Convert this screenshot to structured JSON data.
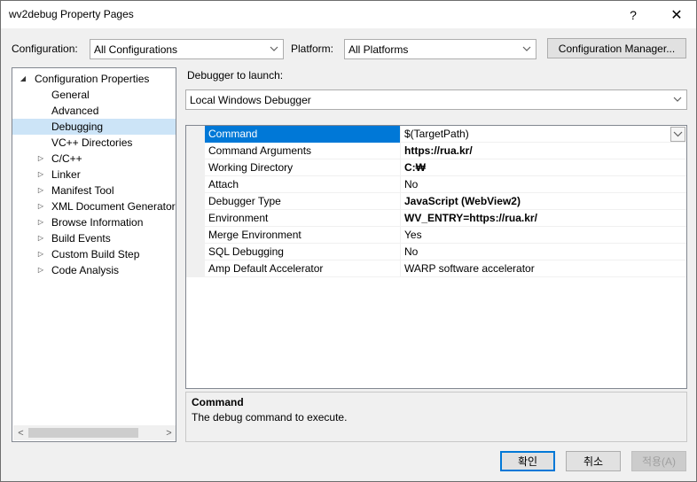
{
  "window": {
    "title": "wv2debug Property Pages",
    "help_glyph": "?",
    "close_glyph": "✕"
  },
  "toolbar": {
    "configuration_label": "Configuration:",
    "configuration_value": "All Configurations",
    "platform_label": "Platform:",
    "platform_value": "All Platforms",
    "config_manager_label": "Configuration Manager..."
  },
  "tree": {
    "items": [
      {
        "label": "Configuration Properties",
        "expander": "◢"
      },
      {
        "label": "General"
      },
      {
        "label": "Advanced"
      },
      {
        "label": "Debugging",
        "selected": true
      },
      {
        "label": "VC++ Directories"
      },
      {
        "label": "C/C++",
        "expander": "▷"
      },
      {
        "label": "Linker",
        "expander": "▷"
      },
      {
        "label": "Manifest Tool",
        "expander": "▷"
      },
      {
        "label": "XML Document Generator",
        "expander": "▷"
      },
      {
        "label": "Browse Information",
        "expander": "▷"
      },
      {
        "label": "Build Events",
        "expander": "▷"
      },
      {
        "label": "Custom Build Step",
        "expander": "▷"
      },
      {
        "label": "Code Analysis",
        "expander": "▷"
      }
    ],
    "scroll_left": "<",
    "scroll_right": ">"
  },
  "debugger": {
    "launch_label": "Debugger to launch:",
    "launch_value": "Local Windows Debugger"
  },
  "properties": [
    {
      "name": "Command",
      "value": "$(TargetPath)",
      "bold": false,
      "selected": true
    },
    {
      "name": "Command Arguments",
      "value": "https://rua.kr/",
      "bold": true
    },
    {
      "name": "Working Directory",
      "value": "C:₩",
      "bold": true
    },
    {
      "name": "Attach",
      "value": "No",
      "bold": false
    },
    {
      "name": "Debugger Type",
      "value": "JavaScript (WebView2)",
      "bold": true
    },
    {
      "name": "Environment",
      "value": "WV_ENTRY=https://rua.kr/",
      "bold": true
    },
    {
      "name": "Merge Environment",
      "value": "Yes",
      "bold": false
    },
    {
      "name": "SQL Debugging",
      "value": "No",
      "bold": false
    },
    {
      "name": "Amp Default Accelerator",
      "value": "WARP software accelerator",
      "bold": false
    }
  ],
  "description": {
    "title": "Command",
    "text": "The debug command to execute."
  },
  "footer": {
    "ok_label": "확인",
    "cancel_label": "취소",
    "apply_label": "적용(A)"
  },
  "colors": {
    "selection": "#0078d7",
    "tree_selection": "#cce4f7"
  }
}
